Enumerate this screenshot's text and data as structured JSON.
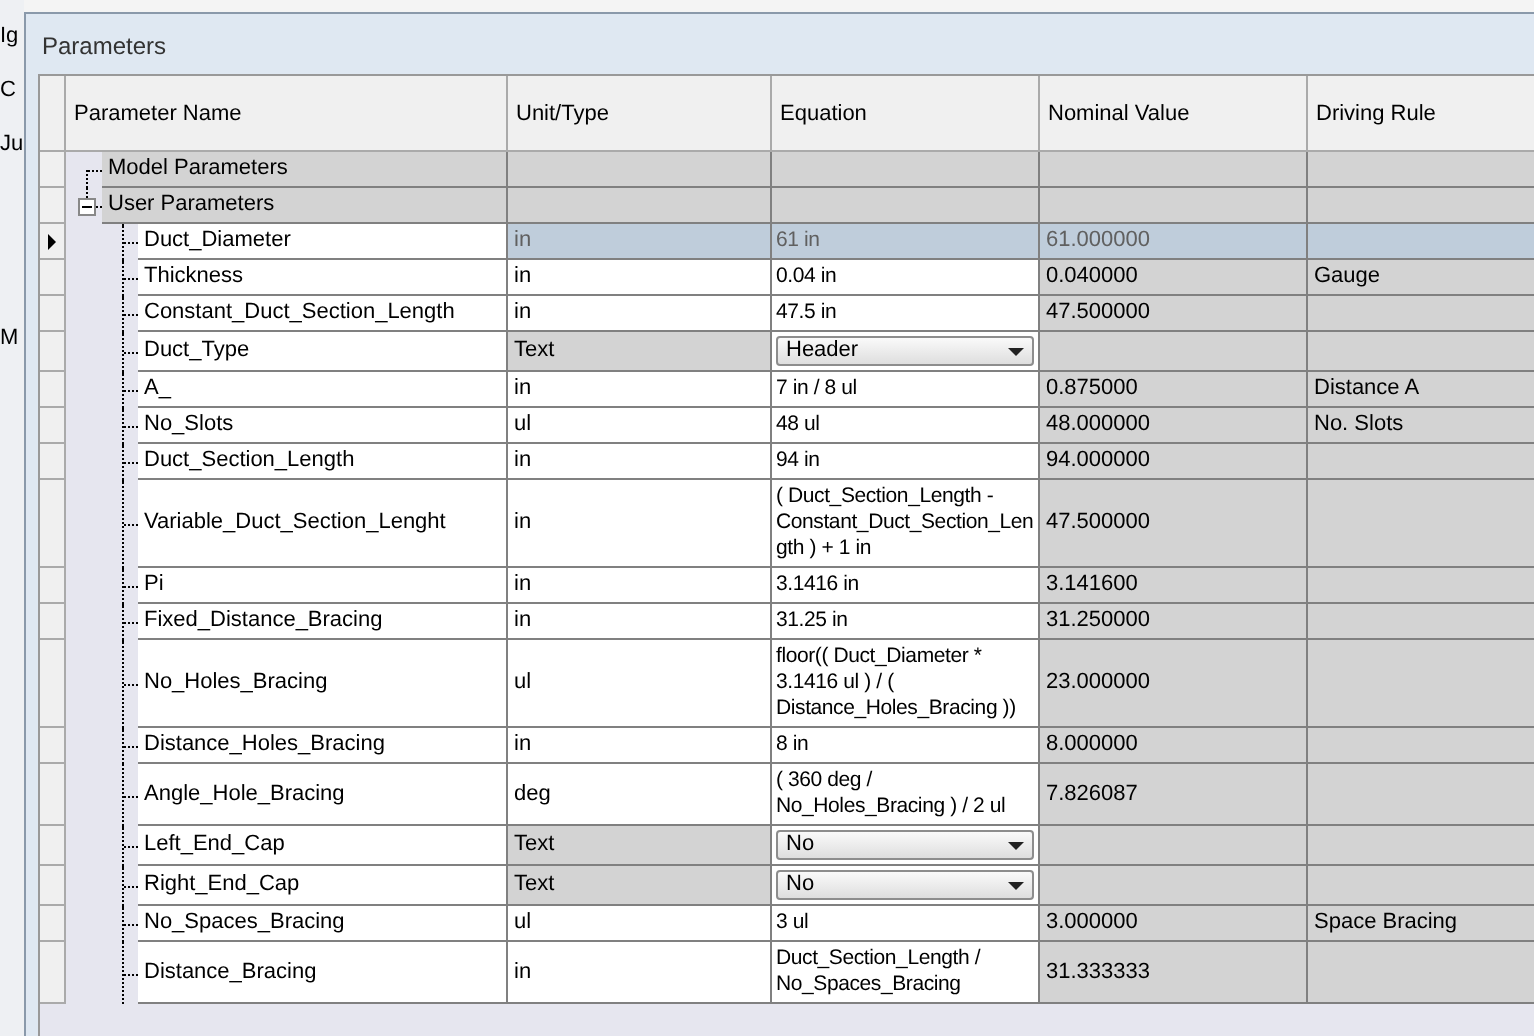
{
  "background": {
    "labels": [
      "Ig",
      "C",
      "Ju",
      "M"
    ]
  },
  "window": {
    "title": "Parameters"
  },
  "table": {
    "columns": [
      "Parameter Name",
      "Unit/Type",
      "Equation",
      "Nominal Value",
      "Driving Rule"
    ],
    "groups": [
      {
        "label": "Model Parameters"
      },
      {
        "label": "User Parameters",
        "expanded": true,
        "children": [
          {
            "kind": "value",
            "selected": true,
            "name": "Duct_Diameter",
            "unit": "in",
            "equation": "61 in",
            "nominal_value": "61.000000"
          },
          {
            "kind": "value",
            "selected": false,
            "name": "Thickness",
            "unit": "in",
            "equation": "0.04 in",
            "nominal_value": "0.040000",
            "driving_rule": "Gauge"
          },
          {
            "kind": "value",
            "selected": false,
            "name": "Constant_Duct_Section_Length",
            "unit": "in",
            "equation": "47.5 in",
            "nominal_value": "47.500000"
          },
          {
            "kind": "dropdown",
            "selected": false,
            "name": "Duct_Type",
            "unit": "Text",
            "equation": "Header"
          },
          {
            "kind": "value",
            "selected": false,
            "name": "A_",
            "unit": "in",
            "equation": "7 in / 8 ul",
            "nominal_value": "0.875000",
            "driving_rule": "Distance A"
          },
          {
            "kind": "value",
            "selected": false,
            "name": "No_Slots",
            "unit": "ul",
            "equation": "48 ul",
            "nominal_value": "48.000000",
            "driving_rule": "No. Slots"
          },
          {
            "kind": "value",
            "selected": false,
            "name": "Duct_Section_Length",
            "unit": "in",
            "equation": "94 in",
            "nominal_value": "94.000000"
          },
          {
            "kind": "value",
            "selected": false,
            "name": "Variable_Duct_Section_Lenght",
            "unit": "in",
            "equation": "( Duct_Section_Length - Constant_Duct_Section_Length ) + 1 in",
            "nominal_value": "47.500000"
          },
          {
            "kind": "value",
            "selected": false,
            "name": "Pi",
            "unit": "in",
            "equation": "3.1416 in",
            "nominal_value": "3.141600"
          },
          {
            "kind": "value",
            "selected": false,
            "name": "Fixed_Distance_Bracing",
            "unit": "in",
            "equation": "31.25 in",
            "nominal_value": "31.250000"
          },
          {
            "kind": "value",
            "selected": false,
            "name": "No_Holes_Bracing",
            "unit": "ul",
            "equation": "floor(( Duct_Diameter * 3.1416 ul ) / ( Distance_Holes_Bracing ))",
            "nominal_value": "23.000000"
          },
          {
            "kind": "value",
            "selected": false,
            "name": "Distance_Holes_Bracing",
            "unit": "in",
            "equation": "8 in",
            "nominal_value": "8.000000"
          },
          {
            "kind": "value",
            "selected": false,
            "name": "Angle_Hole_Bracing",
            "unit": "deg",
            "equation": "( 360 deg / No_Holes_Bracing ) / 2 ul",
            "nominal_value": "7.826087"
          },
          {
            "kind": "dropdown",
            "selected": false,
            "name": "Left_End_Cap",
            "unit": "Text",
            "equation": "No"
          },
          {
            "kind": "dropdown",
            "selected": false,
            "name": "Right_End_Cap",
            "unit": "Text",
            "equation": "No"
          },
          {
            "kind": "value",
            "selected": false,
            "name": "No_Spaces_Bracing",
            "unit": "ul",
            "equation": "3 ul",
            "nominal_value": "3.000000",
            "driving_rule": "Space Bracing"
          },
          {
            "kind": "value",
            "selected": false,
            "name": "Distance_Bracing",
            "unit": "in",
            "equation": "Duct_Section_Length / No_Spaces_Bracing",
            "nominal_value": "31.333333"
          }
        ]
      }
    ]
  }
}
